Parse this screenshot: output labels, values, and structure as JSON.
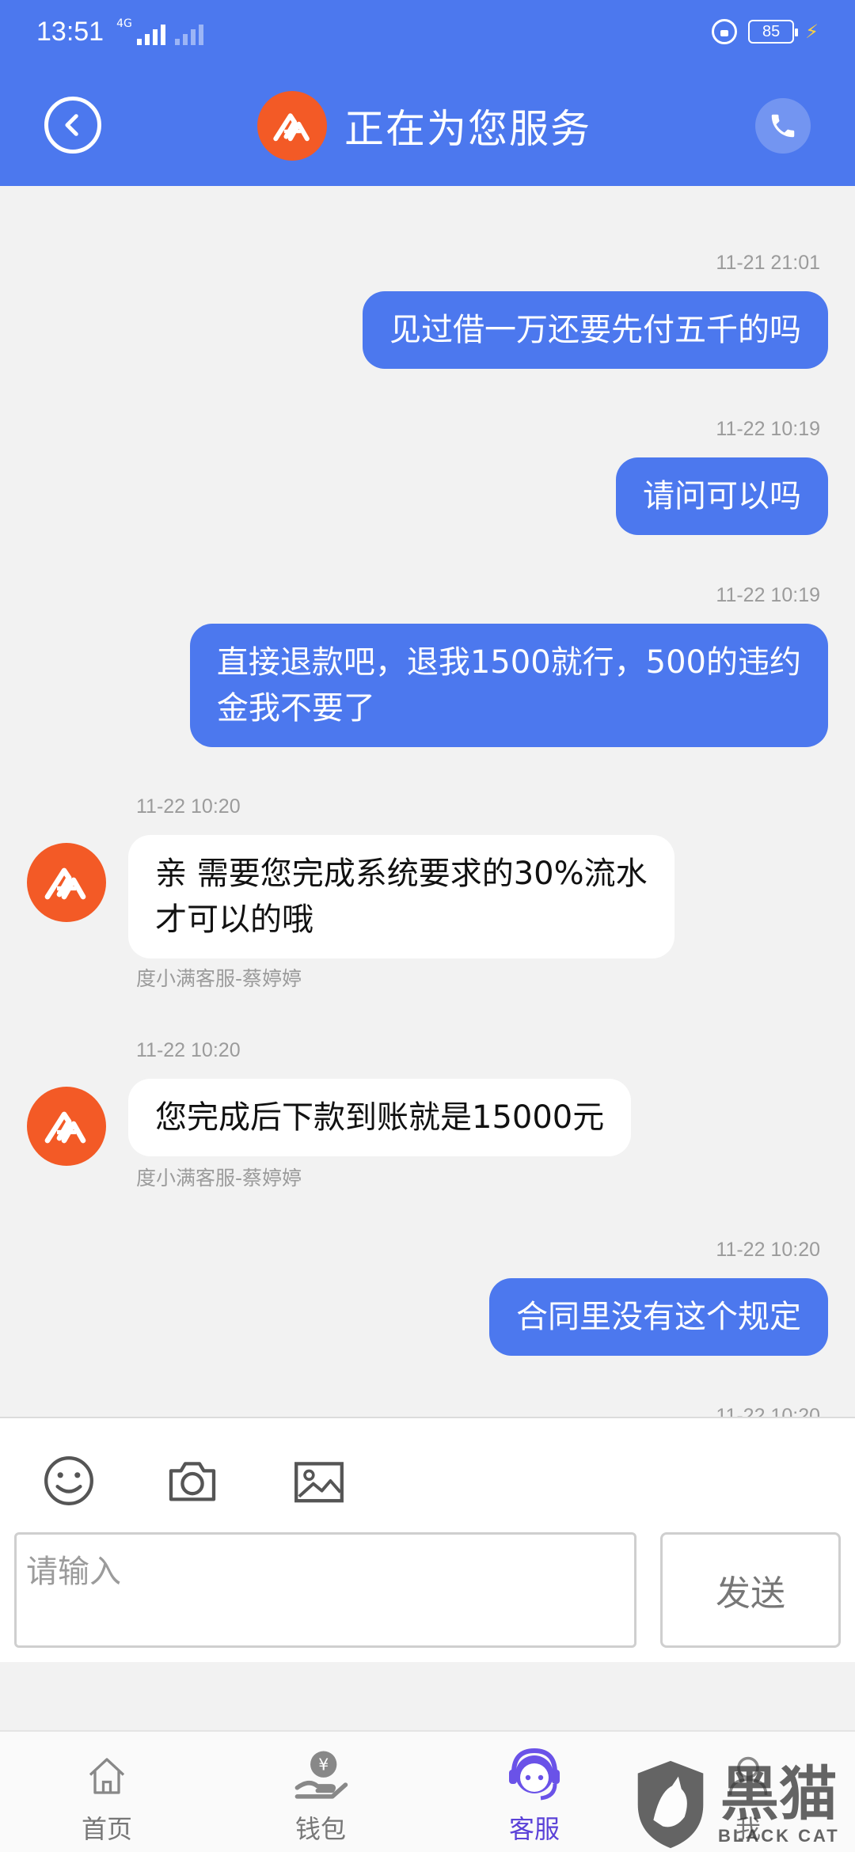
{
  "status_bar": {
    "time": "13:51",
    "network": "4G",
    "battery": "85"
  },
  "header": {
    "title": "正在为您服务"
  },
  "messages": [
    {
      "time": "11-21 21:01",
      "side": "out",
      "lines": [
        "见过借一万还要先付五千的吗"
      ]
    },
    {
      "time": "11-22 10:19",
      "side": "out",
      "lines": [
        "请问可以吗"
      ]
    },
    {
      "time": "11-22 10:19",
      "side": "out",
      "lines": [
        "直接退款吧，退我1500就行，500的违约",
        "金我不要了"
      ]
    },
    {
      "time": "11-22 10:20",
      "side": "in",
      "lines": [
        "亲  需要您完成系统要求的30%流水",
        "才可以的哦"
      ],
      "agent": "度小满客服-蔡婷婷"
    },
    {
      "time": "11-22 10:20",
      "side": "in",
      "lines": [
        "您完成后下款到账就是15000元"
      ],
      "agent": "度小满客服-蔡婷婷"
    },
    {
      "time": "11-22 10:20",
      "side": "out",
      "lines": [
        "合同里没有这个规定"
      ]
    },
    {
      "time": "11-22 10:20",
      "side": "out",
      "lines": []
    }
  ],
  "input": {
    "placeholder": "请输入",
    "send_label": "发送"
  },
  "nav": {
    "items": [
      {
        "label": "首页",
        "icon": "home-icon"
      },
      {
        "label": "钱包",
        "icon": "wallet-icon"
      },
      {
        "label": "客服",
        "icon": "customer-service-icon"
      },
      {
        "label": "我",
        "icon": "profile-icon"
      }
    ],
    "active_index": 2
  },
  "watermark": {
    "cn": "黑猫",
    "en": "BLACK CAT"
  },
  "colors": {
    "primary": "#4c78ee",
    "logo": "#f35a26",
    "active_nav": "#5b42d8"
  }
}
